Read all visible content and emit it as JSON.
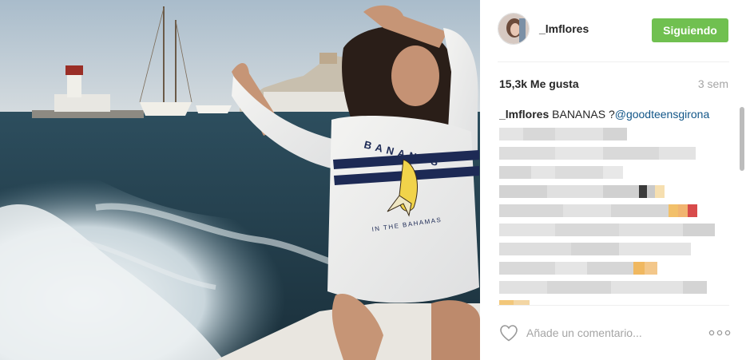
{
  "post": {
    "username": "_lmflores",
    "follow_label": "Siguiendo",
    "likes": "15,3k Me gusta",
    "time_ago": "3 sem",
    "caption": {
      "user": "_lmflores",
      "text": " BANANAS ?",
      "mention": "@goodteensgirona"
    },
    "comment_placeholder": "Añade un comentario...",
    "more_label": "ooo"
  },
  "photo": {
    "sweater_text_top": "BANANAS",
    "sweater_text_bottom": "IN THE BAHAMAS"
  },
  "colors": {
    "follow_green": "#70c050",
    "mention_blue": "#125688",
    "muted_gray": "#a5a5a5"
  },
  "icons": {
    "like": "heart-outline-icon",
    "more": "more-options-icon"
  }
}
